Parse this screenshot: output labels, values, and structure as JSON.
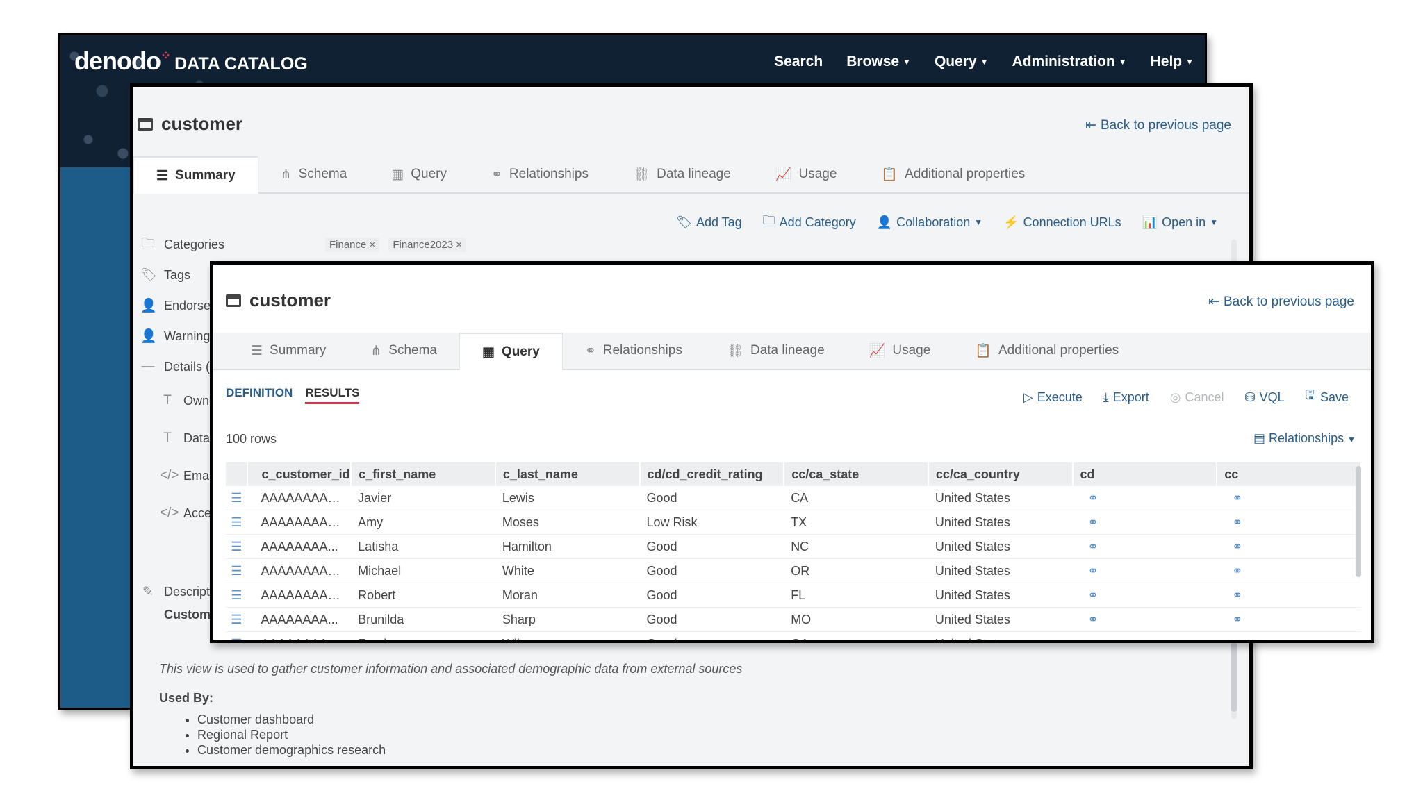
{
  "app": {
    "brand": "denodo",
    "product": "DATA CATALOG",
    "nav": [
      {
        "label": "Search",
        "caret": false
      },
      {
        "label": "Browse",
        "caret": true
      },
      {
        "label": "Query",
        "caret": true
      },
      {
        "label": "Administration",
        "caret": true
      },
      {
        "label": "Help",
        "caret": true
      }
    ]
  },
  "summary_view": {
    "title": "customer",
    "back": "Back to previous page",
    "tabs": [
      "Summary",
      "Schema",
      "Query",
      "Relationships",
      "Data lineage",
      "Usage",
      "Additional properties"
    ],
    "active_tab": "Summary",
    "actions": {
      "add_tag": "Add Tag",
      "add_category": "Add Category",
      "collaboration": "Collaboration",
      "connection_urls": "Connection URLs",
      "open_in": "Open in"
    },
    "side": {
      "categories": "Categories",
      "tags": "Tags",
      "endorsed": "Endorse",
      "warnings": "Warning",
      "details": "Details (",
      "owner": "Owne",
      "data": "Data",
      "email": "Email",
      "access": "Acces",
      "description": "Descripti",
      "customer": "Custome"
    },
    "category_chips": [
      "Finance",
      "Finance2023"
    ],
    "description_text": "This view is used to gather customer information and associated demographic data from external sources",
    "used_by_label": "Used By:",
    "used_by": [
      "Customer dashboard",
      "Regional Report",
      "Customer demographics research"
    ]
  },
  "query_view": {
    "title": "customer",
    "back": "Back to previous page",
    "tabs": [
      "Summary",
      "Schema",
      "Query",
      "Relationships",
      "Data lineage",
      "Usage",
      "Additional properties"
    ],
    "active_tab": "Query",
    "subtabs": {
      "definition": "DEFINITION",
      "results": "RESULTS"
    },
    "actions": {
      "execute": "Execute",
      "export": "Export",
      "cancel": "Cancel",
      "vql": "VQL",
      "save": "Save"
    },
    "row_count": "100 rows",
    "relationships_button": "Relationships",
    "columns": [
      "c_customer_id",
      "c_first_name",
      "c_last_name",
      "cd/cd_credit_rating",
      "cc/ca_state",
      "cc/ca_country",
      "cd",
      "cc"
    ],
    "rows": [
      [
        "AAAAAAAAB...",
        "Javier",
        "Lewis",
        "Good",
        "CA",
        "United States"
      ],
      [
        "AAAAAAAAC...",
        "Amy",
        "Moses",
        "Low Risk",
        "TX",
        "United States"
      ],
      [
        "AAAAAAAA...",
        "Latisha",
        "Hamilton",
        "Good",
        "NC",
        "United States"
      ],
      [
        "AAAAAAAAE...",
        "Michael",
        "White",
        "Good",
        "OR",
        "United States"
      ],
      [
        "AAAAAAAAF...",
        "Robert",
        "Moran",
        "Good",
        "FL",
        "United States"
      ],
      [
        "AAAAAAAA...",
        "Brunilda",
        "Sharp",
        "Good",
        "MO",
        "United States"
      ],
      [
        "AAAAAAAA...",
        "Fonda",
        "Wiles",
        "Good",
        "GA",
        "United States"
      ]
    ]
  },
  "colors": {
    "link": "#2a5d8a",
    "accent": "#d9364f",
    "header_bg": "#0f2133"
  }
}
